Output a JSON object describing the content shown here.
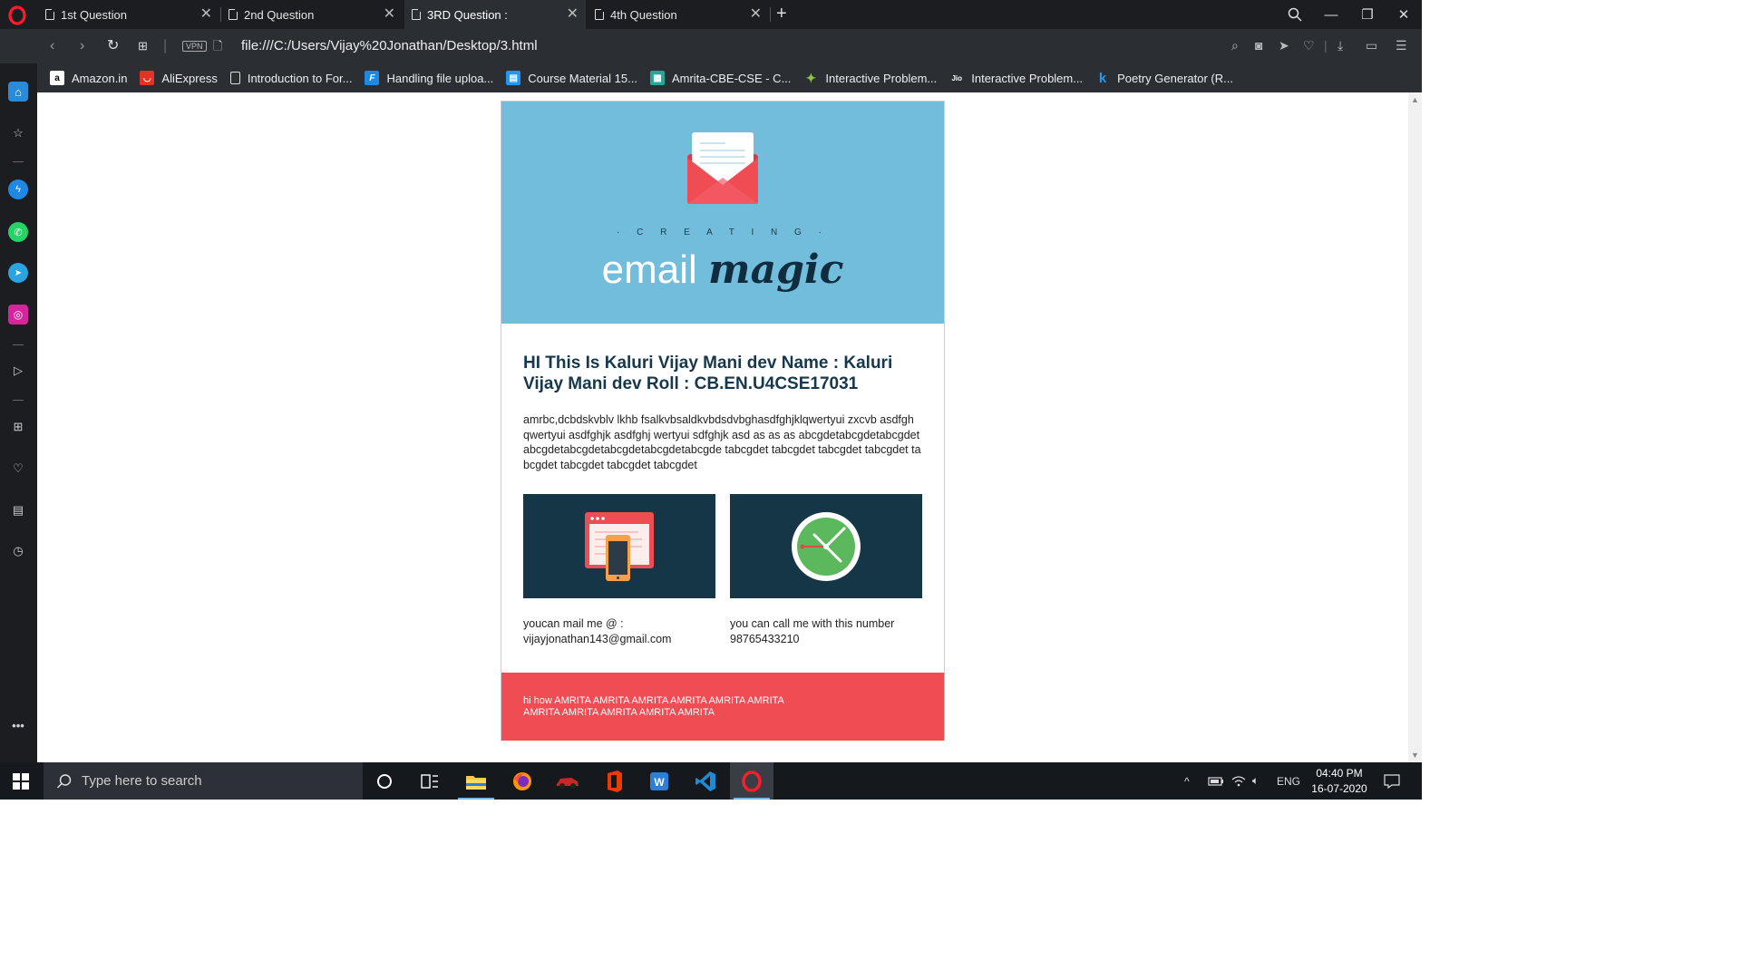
{
  "browser": {
    "tabs": [
      {
        "label": "1st Question",
        "active": false
      },
      {
        "label": "2nd Question",
        "active": false
      },
      {
        "label": "3RD Question :",
        "active": true
      },
      {
        "label": "4th Question",
        "active": false
      }
    ],
    "url": "file:///C:/Users/Vijay%20Jonathan/Desktop/3.html",
    "vpn_label": "VPN",
    "bookmarks": [
      {
        "label": "Amazon.in",
        "icon": "amazon-icon",
        "color": "#ffffff"
      },
      {
        "label": "AliExpress",
        "icon": "aliexpress-icon",
        "color": "#e43225"
      },
      {
        "label": "Introduction to For...",
        "icon": "page-icon",
        "color": "#dddddd"
      },
      {
        "label": "Handling file uploa...",
        "icon": "f-icon",
        "color": "#1e88e5"
      },
      {
        "label": "Course Material 15...",
        "icon": "course-icon",
        "color": "#2196f3"
      },
      {
        "label": "Amrita-CBE-CSE - C...",
        "icon": "amrita-icon",
        "color": "#26a69a"
      },
      {
        "label": "Interactive Problem...",
        "icon": "star-icon",
        "color": "#8bc34a"
      },
      {
        "label": "Interactive Problem...",
        "icon": "jio-icon",
        "color": "#1a237e"
      },
      {
        "label": "Poetry Generator (R...",
        "icon": "k-icon",
        "color": "#2196f3"
      }
    ]
  },
  "email": {
    "hero_kicker": "· C R E A T I N G ·",
    "hero_title_plain": "email ",
    "hero_title_script": "magic",
    "headline": "HI This Is Kaluri Vijay Mani dev Name : Kaluri Vijay Mani dev Roll : CB.EN.U4CSE17031",
    "paragraph": "amrbc,dcbdskvblv lkhb fsalkvbsaldkvbdsdvbghasdfghjklqwertyui zxcvb asdfgh qwertyui asdfghjk asdfghj wertyui sdfghjk asd as as as abcgdetabcgdetabcgdetabcgdetabcgdetabcgdetabcgdetabcgde tabcgdet tabcgdet tabcgdet tabcgdet tabcgdet tabcgdet tabcgdet tabcgdet",
    "col_left_line1": "youcan mail me @ :",
    "col_left_line2": "vijayjonathan143@gmail.com",
    "col_right_line1": "you can call me with this number",
    "col_right_line2": "98765433210",
    "footer_line1": "hi how AMRITA AMRITA AMRITA AMRITA AMRITA AMRITA",
    "footer_line2": "AMRITA AMRITA AMRITA AMRITA AMRITA"
  },
  "colors": {
    "hero_bg": "#72bcdc",
    "card_bg": "#153646",
    "footer_bg": "#ef4c54",
    "headline": "#15384c"
  },
  "taskbar": {
    "search_placeholder": "Type here to search",
    "language": "ENG",
    "time": "04:40 PM",
    "date": "16-07-2020"
  }
}
